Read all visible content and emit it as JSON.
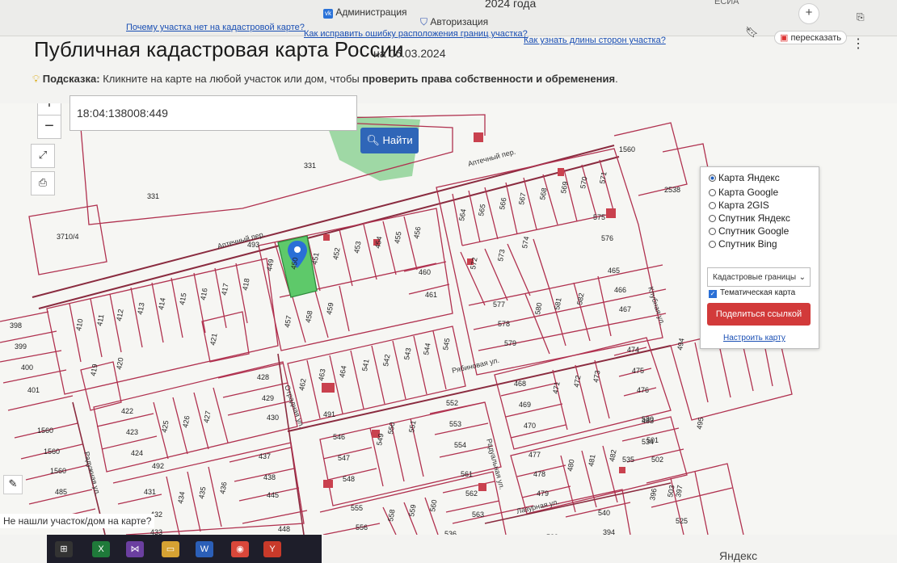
{
  "topbar": {
    "year_text": "2024 года",
    "esia": "ЕСИА",
    "admin_label": "Администрация",
    "auth_label": "Авторизация",
    "retell_label": "пересказать",
    "links": [
      "Почему участка нет на кадастровой карте?",
      "Как исправить ошибку расположения границ участка?",
      "Как узнать длины сторон участка?"
    ]
  },
  "header": {
    "title": "Публичная кадастровая карта России",
    "date": "на 06.03.2024",
    "hint_label": "Подсказка:",
    "hint_text": "Кликните на карте на любой участок или дом, чтобы",
    "hint_bold": "проверить права собственности и обременения",
    "hint_end": "."
  },
  "map": {
    "search_value": "18:04:138008:449",
    "search_button": "Найти",
    "zoom_in": "+",
    "zoom_out": "−",
    "streets": [
      "Аптечный пер.",
      "Аптечный пер.",
      "Рябиновая ул.",
      "Отрадная ул.",
      "Радужная ул.",
      "Радуальная ул.",
      "Лазурная ул.",
      "Клубная ул."
    ],
    "parcels": [
      "331",
      "331",
      "3710/4",
      "1560",
      "2538",
      "410",
      "411",
      "412",
      "413",
      "414",
      "415",
      "416",
      "417",
      "418",
      "419",
      "420",
      "421",
      "422",
      "423",
      "424",
      "425",
      "426",
      "427",
      "428",
      "429",
      "430",
      "431",
      "432",
      "433",
      "434",
      "435",
      "436",
      "437",
      "438",
      "445",
      "448",
      "449",
      "450",
      "451",
      "452",
      "453",
      "454",
      "455",
      "456",
      "457",
      "458",
      "459",
      "460",
      "461",
      "462",
      "463",
      "464",
      "541",
      "542",
      "543",
      "544",
      "545",
      "546",
      "547",
      "548",
      "549",
      "550",
      "551",
      "552",
      "553",
      "554",
      "555",
      "556",
      "557",
      "558",
      "559",
      "560",
      "561",
      "562",
      "563",
      "564",
      "565",
      "566",
      "567",
      "568",
      "569",
      "570",
      "571",
      "572",
      "573",
      "574",
      "575",
      "576",
      "577",
      "578",
      "579",
      "580",
      "581",
      "582",
      "465",
      "466",
      "467",
      "468",
      "469",
      "470",
      "471",
      "472",
      "473",
      "474",
      "475",
      "476",
      "477",
      "478",
      "479",
      "480",
      "481",
      "482",
      "483",
      "501",
      "502",
      "503",
      "525",
      "530",
      "534",
      "535",
      "536",
      "539",
      "540",
      "394",
      "395",
      "396",
      "397",
      "398",
      "399",
      "400",
      "401",
      "1560",
      "1560",
      "1560",
      "485",
      "491",
      "492",
      "493",
      "494",
      "495"
    ]
  },
  "layers": {
    "options": [
      "Карта Яндекс",
      "Карта Google",
      "Карта 2GIS",
      "Спутник Яндекс",
      "Спутник Google",
      "Спутник Bing"
    ],
    "selected_index": 0,
    "select_value": "Кадастровые границы",
    "thematic_label": "Тематическая карта",
    "thematic_checked": true,
    "share_button": "Поделиться ссылкой",
    "configure_link": "Настроить карту"
  },
  "not_found_text": "Не нашли участок/дом на карте?",
  "yandex_watermark": "Яндекс",
  "colors": {
    "parcel_stroke": "#b0314f",
    "selected_parcel": "#5ec96a",
    "street": "#8a2b3f",
    "park": "#9fd8a5",
    "building": "#c9414e",
    "search_button": "#2f66b8",
    "share_button": "#d23a3a"
  }
}
